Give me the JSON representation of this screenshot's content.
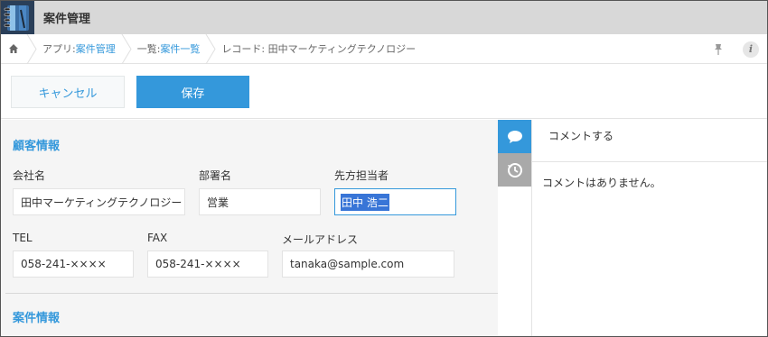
{
  "header": {
    "app_title": "案件管理"
  },
  "breadcrumb": {
    "app_prefix": "アプリ: ",
    "app_name": "案件管理",
    "list_prefix": "一覧: ",
    "list_name": "案件一覧",
    "record_label": "レコード: 田中マーケティングテクノロジー"
  },
  "toolbar": {
    "cancel_label": "キャンセル",
    "save_label": "保存"
  },
  "form": {
    "section1_title": "顧客情報",
    "company_label": "会社名",
    "company_value": "田中マーケティングテクノロジー",
    "department_label": "部署名",
    "department_value": "営業",
    "contact_label": "先方担当者",
    "contact_value": "田中 浩二",
    "tel_label": "TEL",
    "tel_value": "058-241-××××",
    "fax_label": "FAX",
    "fax_value": "058-241-××××",
    "email_label": "メールアドレス",
    "email_value": "tanaka@sample.com",
    "section2_title": "案件情報"
  },
  "comments": {
    "input_placeholder": "コメントする",
    "empty_text": "コメントはありません。"
  },
  "colors": {
    "accent": "#3498db",
    "header_bg": "#d8d8d8",
    "form_bg": "#f5f5f5"
  }
}
